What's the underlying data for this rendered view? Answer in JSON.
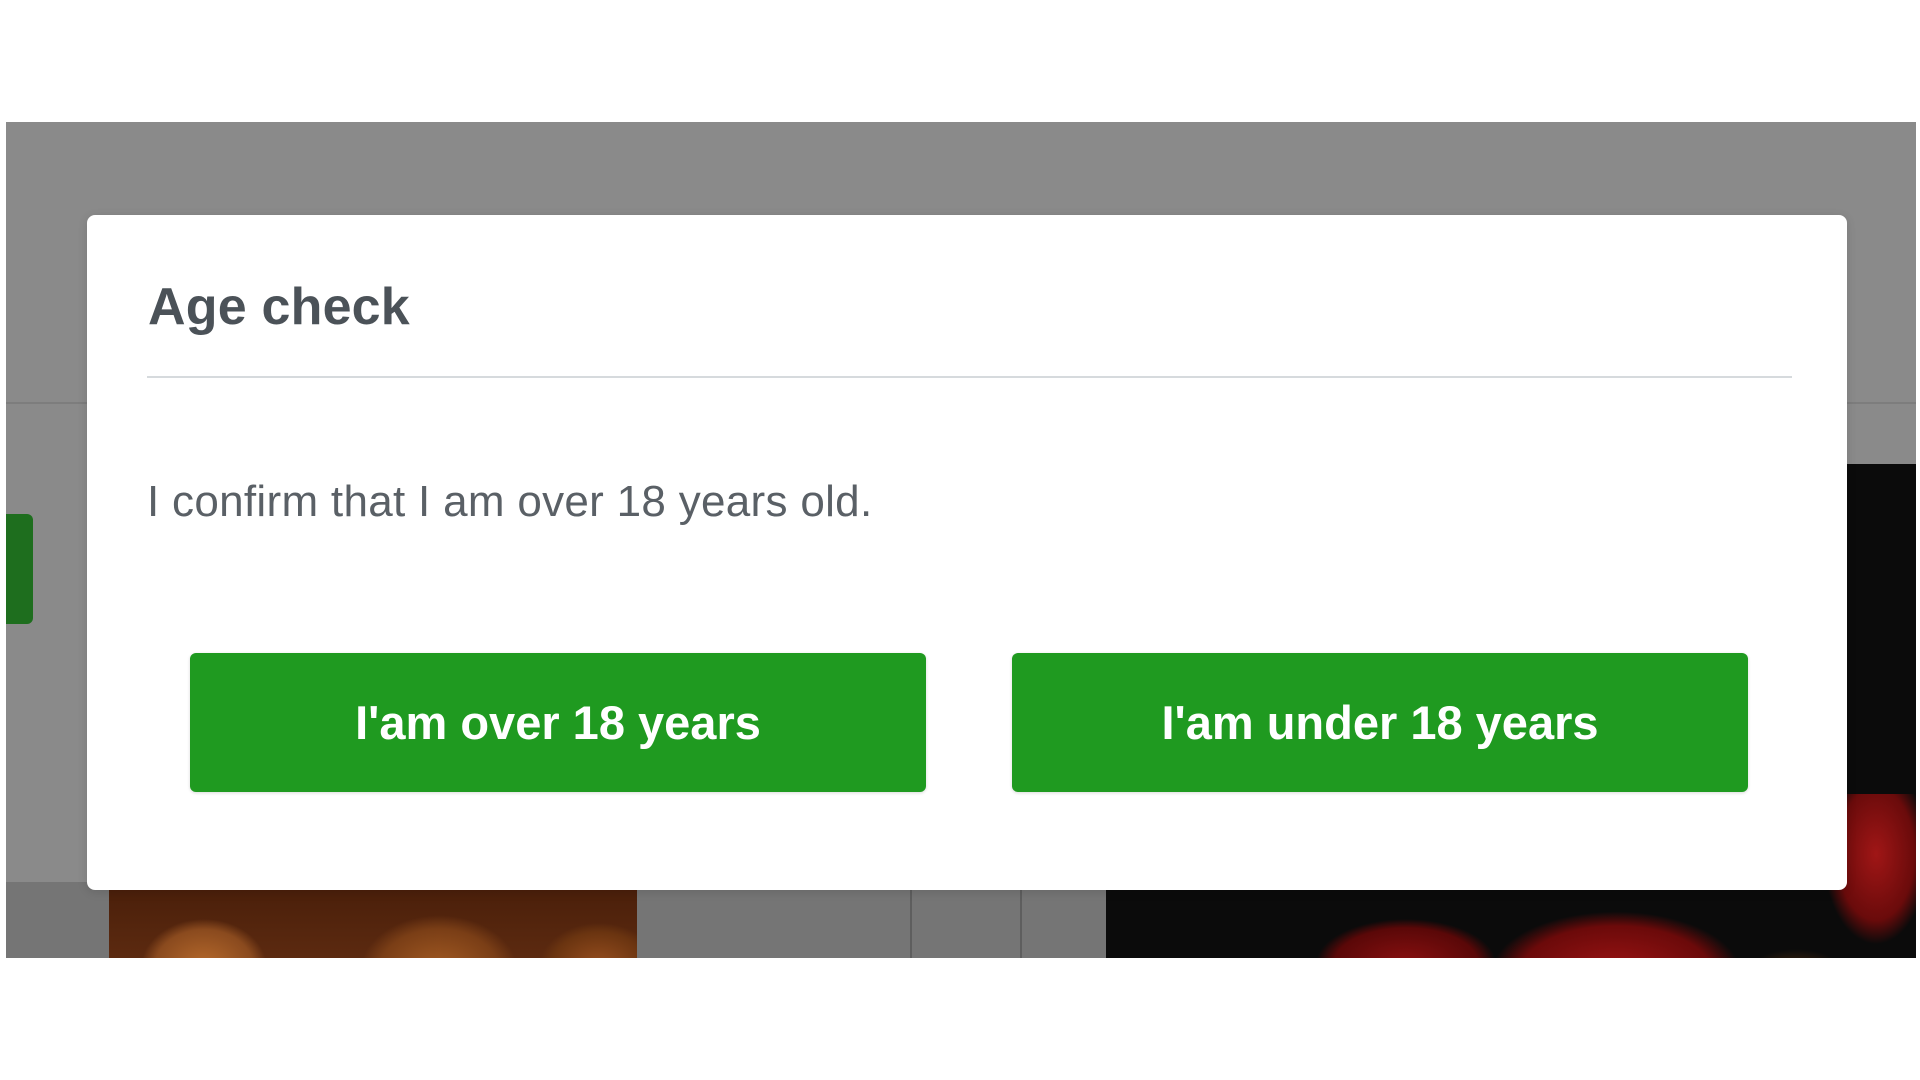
{
  "modal": {
    "title": "Age check",
    "message": "I confirm that I am over 18 years old.",
    "buttons": {
      "over": "I'am over 18 years",
      "under": "I'am under 18 years"
    }
  },
  "colors": {
    "accent_green": "#1f9a20",
    "overlay_gray": "#8a8a8a",
    "title_text": "#4b5258",
    "body_text": "#5a6066"
  }
}
